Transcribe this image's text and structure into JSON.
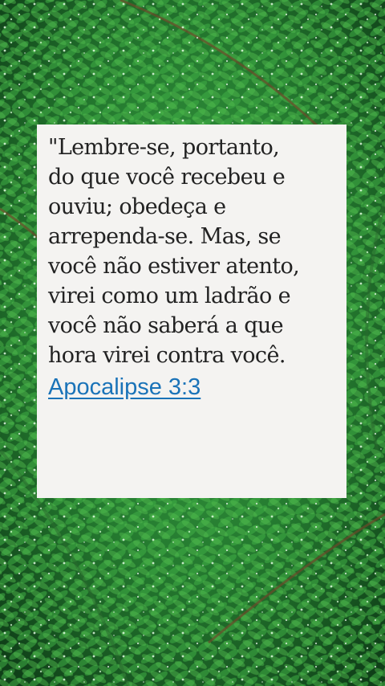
{
  "verse": {
    "text": "\"Lembre-se, portanto,\ndo que você recebeu e\nouviu; obedeça e\narrependa-se. Mas, se\nvocê não estiver atento,\nvirei como um ladrão e\nvocê não saberá a que\nhora virei contra você."
  },
  "reference": {
    "label": "Apocalipse 3:3"
  },
  "colors": {
    "card_background": "#f4f3f1",
    "text": "#222222",
    "link": "#1a73b8",
    "foliage": "#2e8b3a"
  }
}
